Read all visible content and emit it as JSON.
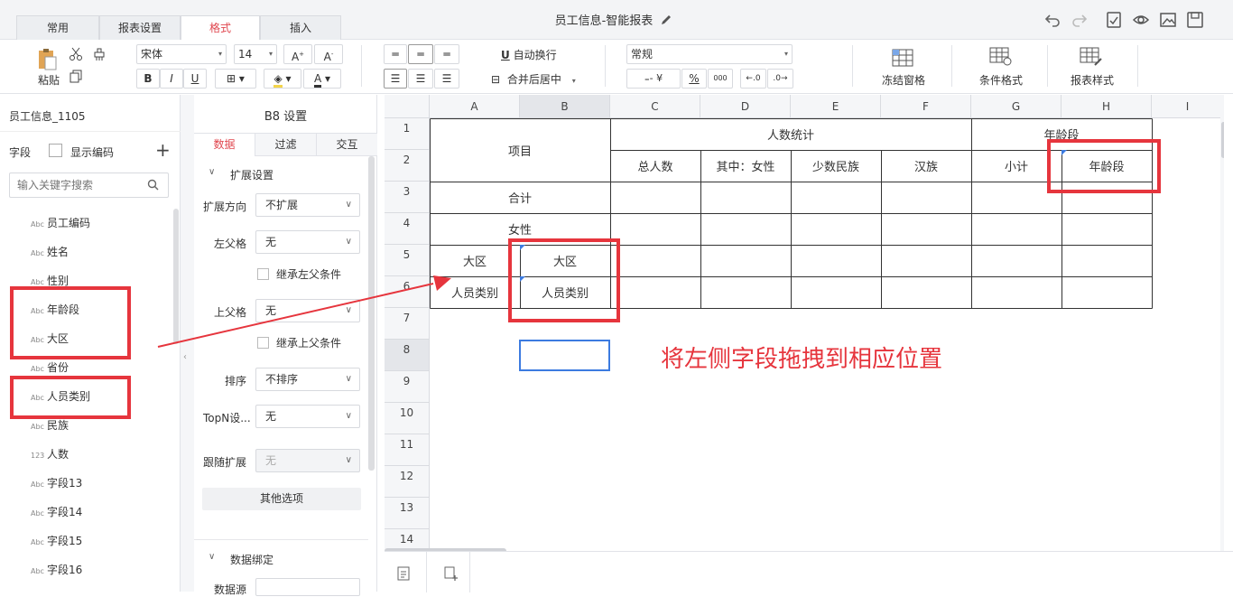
{
  "tabs": [
    {
      "label": "常用",
      "active": false
    },
    {
      "label": "报表设置",
      "active": false
    },
    {
      "label": "格式",
      "active": true
    },
    {
      "label": "插入",
      "active": false
    }
  ],
  "title": "员工信息-智能报表",
  "ribbon": {
    "paste": "粘贴",
    "font": "宋体",
    "font_size": "14",
    "wrap": "自动换行",
    "merge": "合并后居中",
    "number_format": "常规",
    "currency": "¥",
    "percent": "%",
    "thousands": "000",
    "freeze": "冻结窗格",
    "conditional": "条件格式",
    "report_style": "报表样式"
  },
  "fields_panel": {
    "dataset": "员工信息_1105",
    "field_label": "字段",
    "show_code": "显示编码",
    "search_placeholder": "输入关键字搜索",
    "items": [
      {
        "type": "Abc",
        "name": "员工编码"
      },
      {
        "type": "Abc",
        "name": "姓名"
      },
      {
        "type": "Abc",
        "name": "性别"
      },
      {
        "type": "Abc",
        "name": "年龄段"
      },
      {
        "type": "Abc",
        "name": "大区"
      },
      {
        "type": "Abc",
        "name": "省份"
      },
      {
        "type": "Abc",
        "name": "人员类别"
      },
      {
        "type": "Abc",
        "name": "民族"
      },
      {
        "type": "123",
        "name": "人数"
      },
      {
        "type": "Abc",
        "name": "字段13"
      },
      {
        "type": "Abc",
        "name": "字段14"
      },
      {
        "type": "Abc",
        "name": "字段15"
      },
      {
        "type": "Abc",
        "name": "字段16"
      }
    ]
  },
  "settings": {
    "title": "B8 设置",
    "tabs": [
      "数据",
      "过滤",
      "交互"
    ],
    "section_expand": "扩展设置",
    "expand_dir_label": "扩展方向",
    "expand_dir_value": "不扩展",
    "left_parent_label": "左父格",
    "left_parent_value": "无",
    "inherit_left": "继承左父条件",
    "top_parent_label": "上父格",
    "top_parent_value": "无",
    "inherit_top": "继承上父条件",
    "sort_label": "排序",
    "sort_value": "不排序",
    "topn_label": "TopN设...",
    "topn_value": "无",
    "follow_label": "跟随扩展",
    "follow_value": "无",
    "other_button": "其他选项",
    "section_binding": "数据绑定",
    "datasource_label": "数据源"
  },
  "grid": {
    "columns": [
      "A",
      "B",
      "C",
      "D",
      "E",
      "F",
      "G",
      "H",
      "I"
    ],
    "rows": [
      "1",
      "2",
      "3",
      "4",
      "5",
      "6",
      "7",
      "8",
      "9",
      "10",
      "11",
      "12",
      "13",
      "14"
    ],
    "cells": {
      "item": "项目",
      "headcount_stats": "人数统计",
      "total": "总人数",
      "female_of": "其中：女性",
      "minority": "少数民族",
      "han": "汉族",
      "age_group_header": "年龄段",
      "subtotal": "小计",
      "age_group_field": "年龄段",
      "sum": "合计",
      "female": "女性",
      "region_label": "大区",
      "region_field": "大区",
      "staff_type_label": "人员类别",
      "staff_type_field": "人员类别"
    },
    "annotation": "将左侧字段拖拽到相应位置"
  },
  "colors": {
    "accent_red": "#e6353d",
    "selection_blue": "#3c7be0",
    "active_tab": "#e0474f"
  }
}
